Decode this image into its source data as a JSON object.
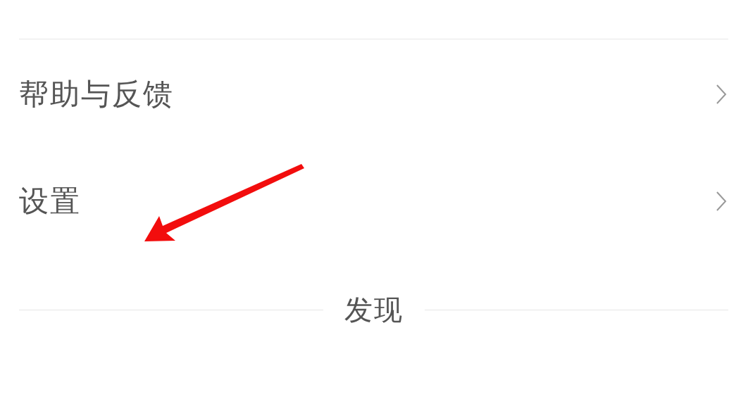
{
  "menu_items": [
    {
      "label": "帮助与反馈"
    },
    {
      "label": "设置"
    }
  ],
  "section_header": {
    "label": "发现"
  },
  "annotations": [
    {
      "kind": "arrow"
    }
  ]
}
